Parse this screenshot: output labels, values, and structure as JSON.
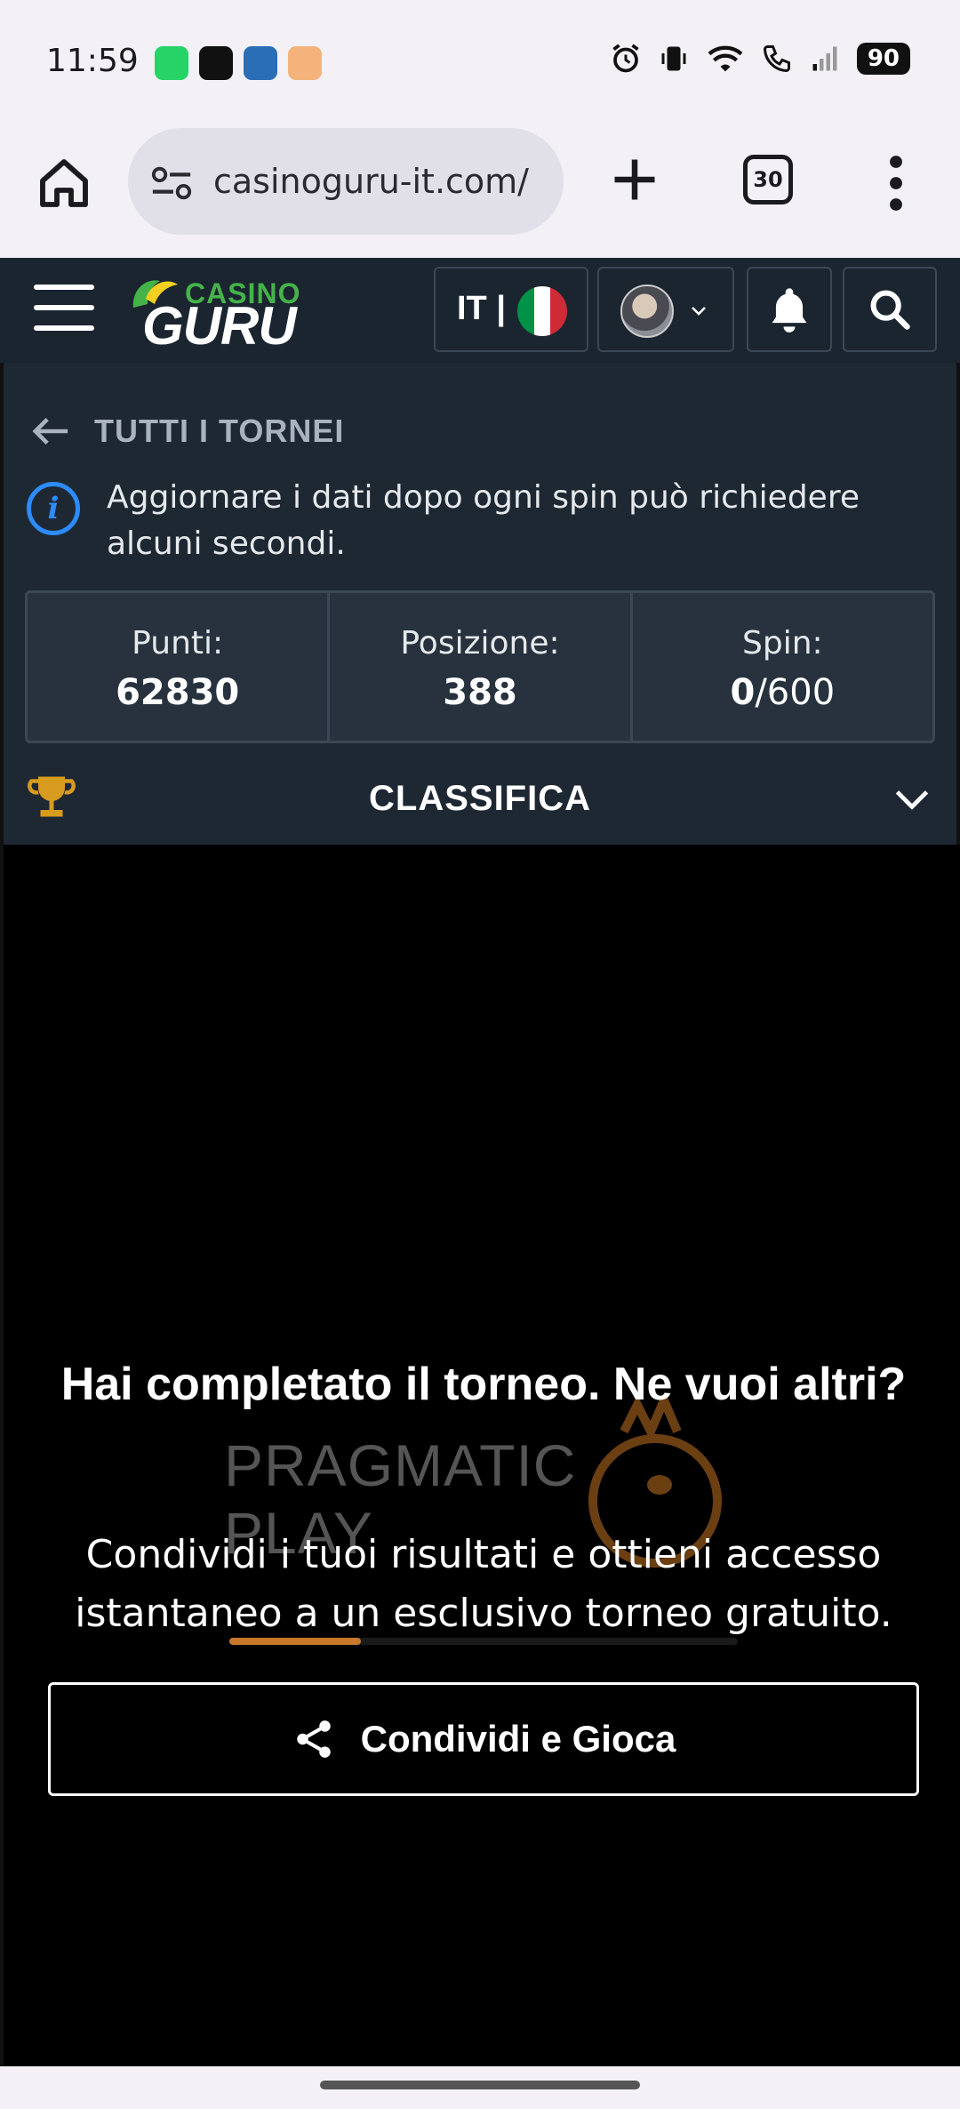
{
  "status_bar": {
    "time": "11:59",
    "battery": "90",
    "notification_icons": [
      {
        "name": "whatsapp-icon",
        "color": "#25d366"
      },
      {
        "name": "tiktok-icon",
        "color": "#111111"
      },
      {
        "name": "app-icon",
        "color": "#2a6fb5"
      },
      {
        "name": "amazon-icon",
        "color": "#f3b37a"
      }
    ]
  },
  "browser": {
    "url": "casinoguru-it.com/",
    "tab_count": "30"
  },
  "header": {
    "logo_top": "CASINO",
    "logo_bottom": "GURU",
    "language": "IT |",
    "flag_colors": [
      "#009246",
      "#ffffff",
      "#ce2b37"
    ]
  },
  "tournament": {
    "back_label": "TUTTI I TORNEI",
    "info_text": "Aggiornare i dati dopo ogni spin può richiedere alcuni secondi.",
    "stats": [
      {
        "label": "Punti:",
        "value": "62830",
        "suffix": ""
      },
      {
        "label": "Posizione:",
        "value": "388",
        "suffix": ""
      },
      {
        "label": "Spin:",
        "value": "0",
        "suffix": "/600"
      }
    ],
    "leaderboard_label": "CLASSIFICA"
  },
  "game": {
    "provider_watermark": "PRAGMATIC PLAY",
    "completed_title": "Hai completato il torneo. Ne vuoi altri?",
    "completed_text": "Condividi i tuoi risultati e ottieni accesso istantaneo a un esclusivo torneo gratuito.",
    "share_button": "Condividi e Gioca"
  },
  "colors": {
    "header_bg": "#1b2530",
    "panel_bg": "#1e2833",
    "accent_blue": "#2d8cff",
    "logo_green": "#45b34a",
    "trophy_gold": "#d79b1e"
  }
}
